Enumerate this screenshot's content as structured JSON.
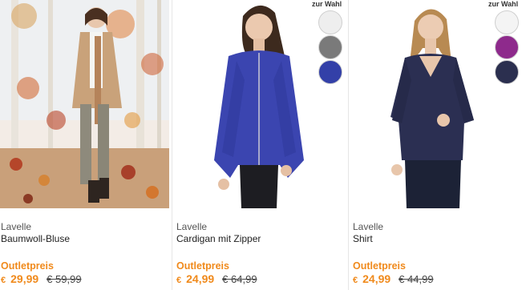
{
  "swatch_header": "zur Wahl",
  "products": [
    {
      "brand": "Lavelle",
      "name": "Baumwoll-Bluse",
      "outlet_label": "Outletpreis",
      "currency": "€",
      "price": "29,99",
      "old_price": "€ 59,99",
      "colors": []
    },
    {
      "brand": "Lavelle",
      "name": "Cardigan mit Zipper",
      "outlet_label": "Outletpreis",
      "currency": "€",
      "price": "24,99",
      "old_price": "€ 64,99",
      "colors": [
        "#eeeeee",
        "#7a7a7a",
        "#3340a8"
      ]
    },
    {
      "brand": "Lavelle",
      "name": "Shirt",
      "outlet_label": "Outletpreis",
      "currency": "€",
      "price": "24,99",
      "old_price": "€ 44,99",
      "colors": [
        "#f4f4f4",
        "#8e2a8c",
        "#2b2f4f"
      ]
    }
  ],
  "accent_color": "#f08a1c"
}
